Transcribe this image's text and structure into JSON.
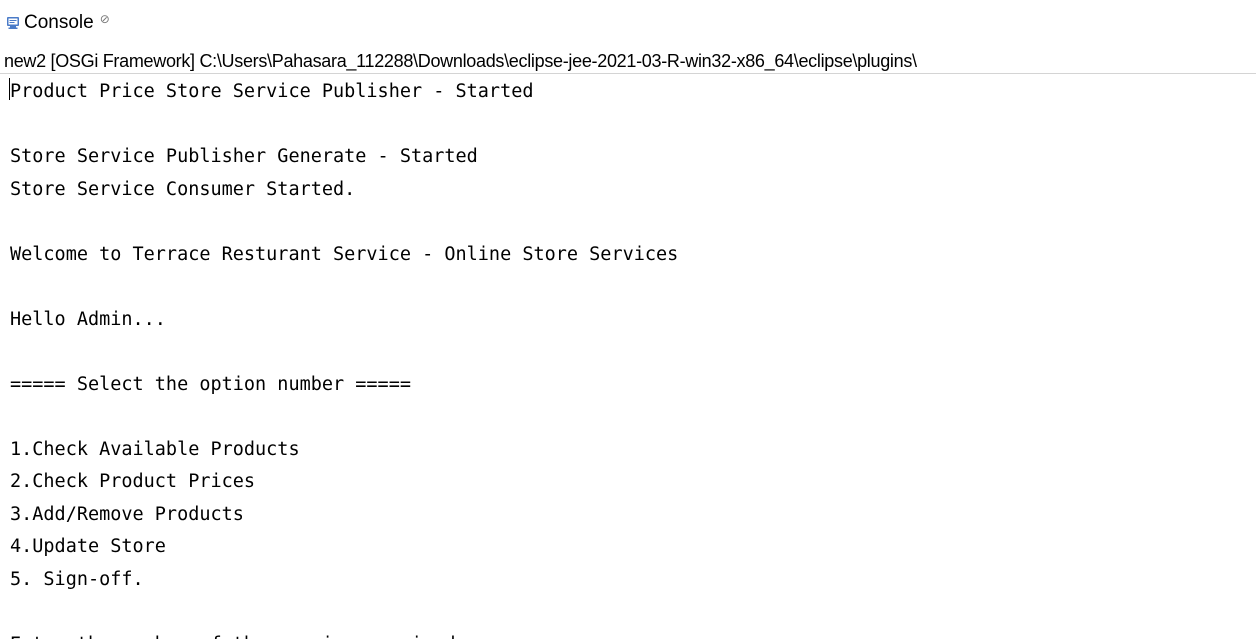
{
  "tab": {
    "label": "Console",
    "close_glyph": "⊘",
    "icon": "console-icon"
  },
  "launch_info": "new2 [OSGi Framework] C:\\Users\\Pahasara_112288\\Downloads\\eclipse-jee-2021-03-R-win32-x86_64\\eclipse\\plugins\\",
  "console": {
    "lines": [
      "Product Price Store Service Publisher - Started",
      "",
      "Store Service Publisher Generate - Started",
      "Store Service Consumer Started.",
      "",
      "Welcome to Terrace Resturant Service - Online Store Services",
      "",
      "Hello Admin...",
      "",
      "===== Select the option number =====",
      "",
      "1.Check Available Products",
      "2.Check Product Prices",
      "3.Add/Remove Products",
      "4.Update Store",
      "5. Sign-off.",
      "",
      "Enter the number of the service required :"
    ]
  },
  "colors": {
    "icon_blue": "#4a7bc8",
    "divider": "#d4d4d4",
    "text": "#000000"
  }
}
